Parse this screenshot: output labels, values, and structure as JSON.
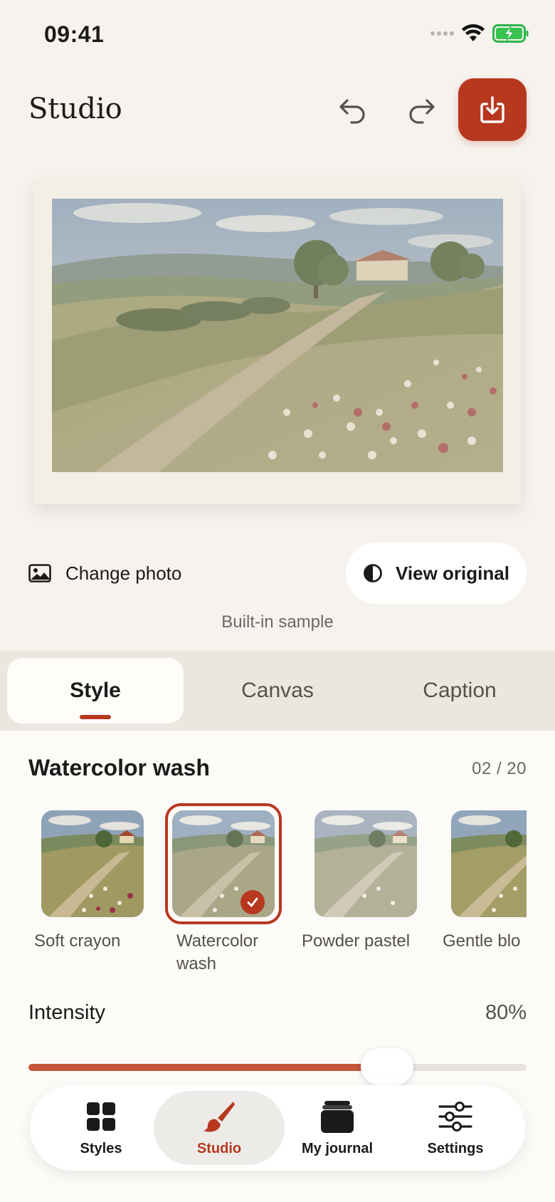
{
  "status_bar": {
    "time": "09:41"
  },
  "header": {
    "title": "Studio",
    "undo_icon": "undo-arrow-icon",
    "redo_icon": "redo-arrow-icon",
    "export_icon": "download-tray-icon"
  },
  "artwork": {
    "subject": "countryside landscape with farmhouse, trees, dirt path and wildflowers"
  },
  "photo_actions": {
    "change_photo_label": "Change photo",
    "view_original_label": "View original",
    "sample_note": "Built-in sample"
  },
  "tabs": [
    {
      "label": "Style",
      "active": true
    },
    {
      "label": "Canvas",
      "active": false
    },
    {
      "label": "Caption",
      "active": false
    }
  ],
  "style_panel": {
    "current_style": "Watercolor wash",
    "counter": "02 / 20",
    "styles": [
      {
        "label": "Soft crayon",
        "selected": false
      },
      {
        "label": "Watercolor wash",
        "selected": true
      },
      {
        "label": "Powder pastel",
        "selected": false
      },
      {
        "label": "Gentle blo",
        "selected": false
      }
    ],
    "intensity_label": "Intensity",
    "intensity_value": "80%",
    "intensity_fraction": 0.72
  },
  "bottom_nav": [
    {
      "label": "Styles",
      "icon": "grid-icon",
      "active": false
    },
    {
      "label": "Studio",
      "icon": "paintbrush-icon",
      "active": true
    },
    {
      "label": "My journal",
      "icon": "journal-icon",
      "active": false
    },
    {
      "label": "Settings",
      "icon": "sliders-icon",
      "active": false
    }
  ],
  "colors": {
    "accent": "#b7381f",
    "background": "#f6f3ee",
    "panel": "#fcfbf8"
  }
}
